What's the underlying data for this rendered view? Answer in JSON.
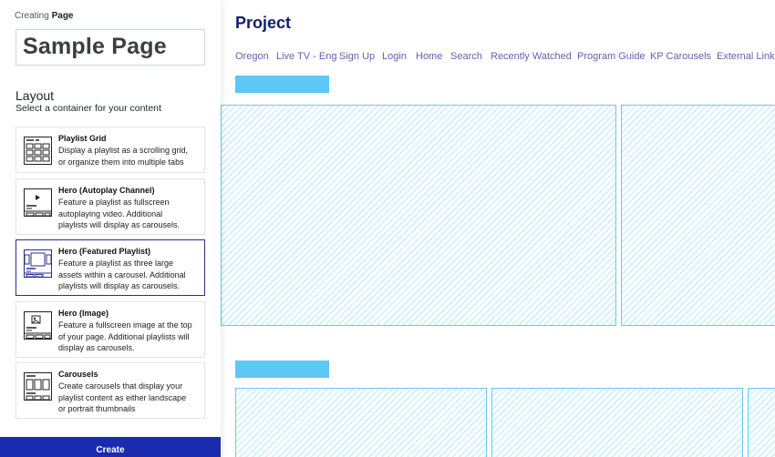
{
  "header": {
    "crumb_prefix": "Creating",
    "crumb_strong": "Page"
  },
  "page_name": {
    "value": "Sample Page"
  },
  "layout": {
    "title": "Layout",
    "subtitle": "Select a container for your content",
    "options": [
      {
        "title": "Playlist Grid",
        "lines": [
          "Display a playlist as a scrolling grid,",
          "or organize them into multiple tabs"
        ],
        "icon": "playlist-grid-icon"
      },
      {
        "title": "Hero (Autoplay Channel)",
        "lines": [
          "Feature a playlist as fullscreen",
          "autoplaying video. Additional",
          "playlists will display as carousels."
        ],
        "icon": "hero-autoplay-icon"
      },
      {
        "title": "Hero (Featured Playlist)",
        "lines": [
          "Feature a playlist as three large",
          "assets within a carousel. Additional",
          "playlists will display as carousels."
        ],
        "icon": "hero-featured-icon",
        "selected": true
      },
      {
        "title": "Hero (Image)",
        "lines": [
          "Feature a fullscreen image at the top",
          "of your page. Additional playlists will",
          "display as carousels."
        ],
        "icon": "hero-image-icon"
      },
      {
        "title": "Carousels",
        "lines": [
          "Create carousels that display your",
          "playlist content as either landscape",
          "or portrait thumbnails"
        ],
        "icon": "carousels-icon"
      }
    ]
  },
  "actions": {
    "create_label": "Create"
  },
  "preview": {
    "title": "Project",
    "nav": [
      "Oregon",
      "Live TV - Eng",
      "Sign Up",
      "Login",
      "Home",
      "Search",
      "Recently Watched",
      "Program Guide",
      "KP Carousels",
      "External Link"
    ]
  },
  "colors": {
    "accent": "#1a2bb0",
    "selected_border": "#2b2d8f",
    "placeholder": "#5bc8f5",
    "nav_link": "#6a5bb8",
    "title": "#0d1e6e"
  }
}
